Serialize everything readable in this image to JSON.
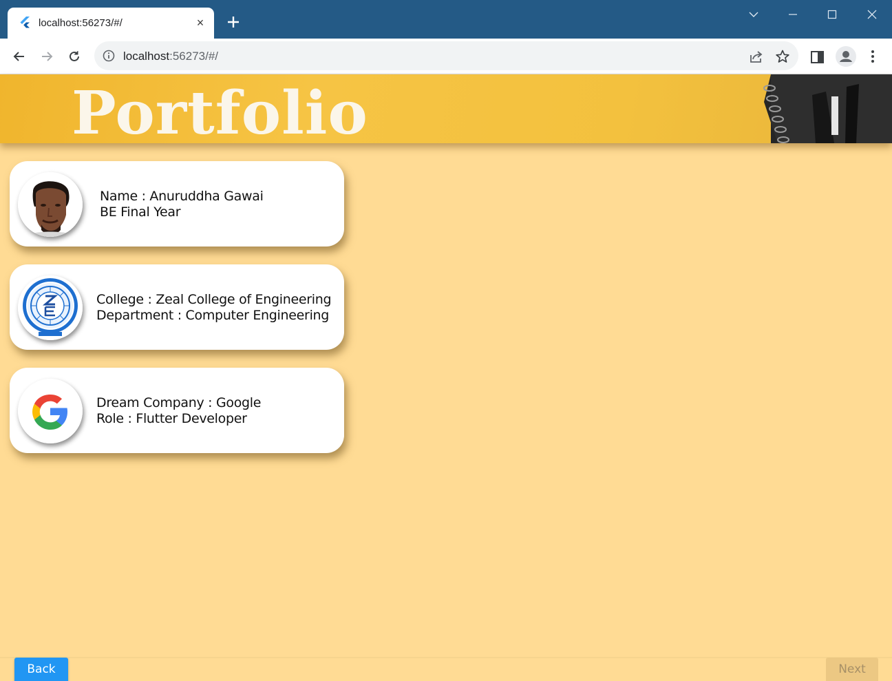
{
  "browser": {
    "tab_title": "localhost:56273/#/",
    "tab_close": "×",
    "url_host": "localhost",
    "url_rest": ":56273/#/",
    "icons": [
      "flutter-favicon",
      "close-icon",
      "plus-icon",
      "chevron-down-icon",
      "minimize-icon",
      "maximize-icon",
      "window-close-icon",
      "back-arrow-icon",
      "forward-arrow-icon",
      "reload-icon",
      "info-icon",
      "share-icon",
      "star-icon",
      "side-panel-icon",
      "profile-icon",
      "kebab-menu-icon"
    ]
  },
  "app": {
    "banner_title": "Portfolio",
    "cards": [
      {
        "line1": "Name : Anuruddha Gawai",
        "line2": "BE Final Year",
        "avatar": "profile-photo"
      },
      {
        "line1": "College : Zeal College of Engineering",
        "line2": "Department : Computer Engineering",
        "avatar": "college-logo"
      },
      {
        "line1": "Dream Company : Google",
        "line2": "Role : Flutter Developer",
        "avatar": "google-logo"
      }
    ],
    "back_label": "Back",
    "next_label": "Next"
  },
  "colors": {
    "titlebar": "#245a86",
    "background": "#ffdb94",
    "banner": "#f6c444",
    "back_button": "#2196f3",
    "next_button_disabled": "#ecc883"
  }
}
